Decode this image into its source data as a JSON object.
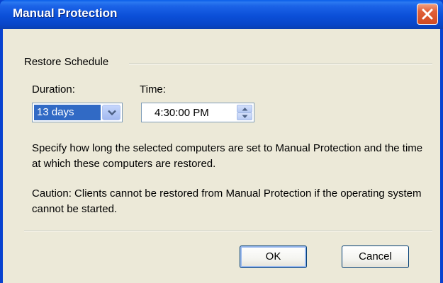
{
  "window": {
    "title": "Manual Protection"
  },
  "icons": {
    "close": "close-icon",
    "dropdown": "chevron-down-icon",
    "spin_up": "chevron-up-icon",
    "spin_down": "chevron-down-icon"
  },
  "colors": {
    "titlebar": "#0b4fd8",
    "close_button": "#d04a22",
    "client_bg": "#ece9d8",
    "selection": "#316ac5"
  },
  "group": {
    "label": "Restore Schedule"
  },
  "duration": {
    "label": "Duration:",
    "value": "13 days"
  },
  "time": {
    "label": "Time:",
    "value": "4:30:00 PM"
  },
  "text": {
    "description": "Specify how long the selected computers are set to Manual Protection and the time at which these computers are restored.",
    "caution": "Caution: Clients cannot be restored from Manual Protection if the operating system cannot be started."
  },
  "buttons": {
    "ok": "OK",
    "cancel": "Cancel"
  }
}
